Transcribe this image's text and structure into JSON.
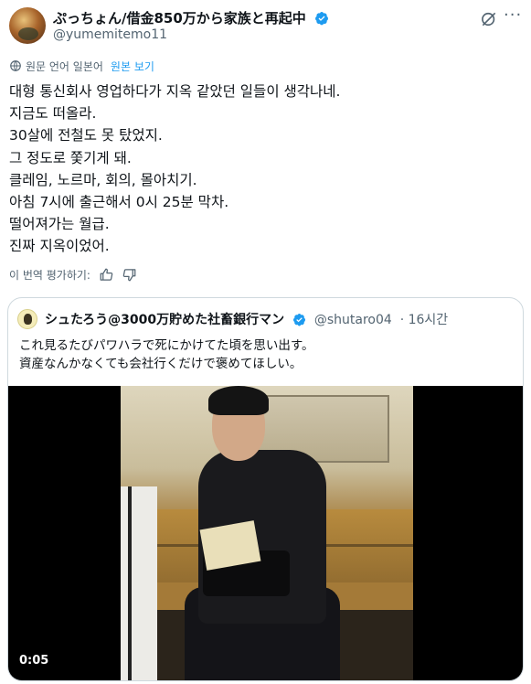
{
  "post": {
    "display_name": "ぷっちょん/借金850万から家族と再起中",
    "handle": "@yumemitemo11",
    "translated_label": "원문 언어 일본어",
    "show_original": "원본 보기",
    "lines": [
      "대형 통신회사 영업하다가 지옥 같았던 일들이 생각나네.",
      "지금도 떠올라.",
      "30살에 전철도 못 탔었지.",
      "그 정도로 쫓기게 돼.",
      "클레임, 노르마, 회의, 몰아치기.",
      "아침 7시에 출근해서 0시 25분 막차.",
      "떨어져가는 월급.",
      "진짜 지옥이었어."
    ],
    "rate_label": "이 번역 평가하기:"
  },
  "quote": {
    "display_name": "シュたろう@3000万貯めた社畜銀行マン",
    "handle": "@shutaro04",
    "time": "· 16시간",
    "lines": [
      "これ見るたびパワハラで死にかけてた頃を思い出す。",
      "資産なんかなくても会社行くだけで褒めてほしい。"
    ],
    "video_time": "0:05"
  },
  "colors": {
    "accent": "#1d9bf0",
    "secondary_text": "#536471",
    "border": "#cfd9de"
  }
}
